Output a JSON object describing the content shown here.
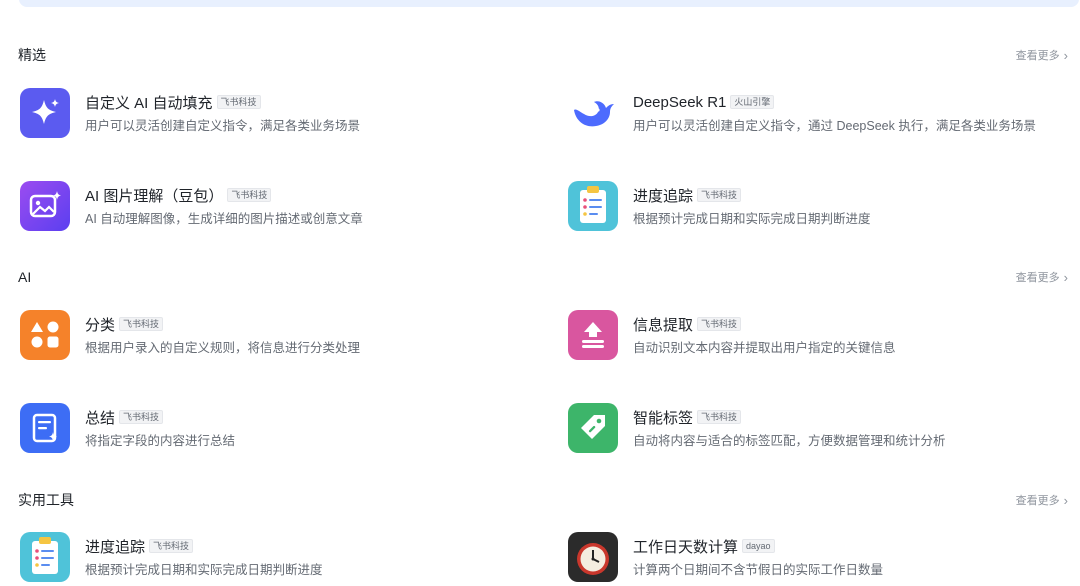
{
  "sections": [
    {
      "title": "精选",
      "see_more": "查看更多",
      "cards": [
        {
          "title": "自定义 AI 自动填充",
          "tag": "飞书科技",
          "desc": "用户可以灵活创建自定义指令，满足各类业务场景",
          "icon": "sparkle-icon",
          "color": "#5b5bf0"
        },
        {
          "title": "DeepSeek R1",
          "tag": "火山引擎",
          "desc": "用户可以灵活创建自定义指令，通过 DeepSeek 执行，满足各类业务场景",
          "icon": "deepseek-whale-icon",
          "color": "#4d6bfe"
        },
        {
          "title": "AI 图片理解（豆包）",
          "tag": "飞书科技",
          "desc": "AI 自动理解图像，生成详细的图片描述或创意文章",
          "icon": "image-sparkle-icon",
          "color": "#7a45f0"
        },
        {
          "title": "进度追踪",
          "tag": "飞书科技",
          "desc": "根据预计完成日期和实际完成日期判断进度",
          "icon": "clipboard-list-icon",
          "color": "#4fc3d9"
        }
      ]
    },
    {
      "title": "AI",
      "see_more": "查看更多",
      "cards": [
        {
          "title": "分类",
          "tag": "飞书科技",
          "desc": "根据用户录入的自定义规则，将信息进行分类处理",
          "icon": "category-shapes-icon",
          "color": "#f5822a"
        },
        {
          "title": "信息提取",
          "tag": "飞书科技",
          "desc": "自动识别文本内容并提取出用户指定的关键信息",
          "icon": "extract-upload-icon",
          "color": "#d9569f"
        },
        {
          "title": "总结",
          "tag": "飞书科技",
          "desc": "将指定字段的内容进行总结",
          "icon": "summary-doc-icon",
          "color": "#3d6df5"
        },
        {
          "title": "智能标签",
          "tag": "飞书科技",
          "desc": "自动将内容与适合的标签匹配，方便数据管理和统计分析",
          "icon": "tag-icon",
          "color": "#3db56a"
        }
      ]
    },
    {
      "title": "实用工具",
      "see_more": "查看更多",
      "cards": [
        {
          "title": "进度追踪",
          "tag": "飞书科技",
          "desc": "根据预计完成日期和实际完成日期判断进度",
          "icon": "clipboard-list-icon",
          "color": "#4fc3d9"
        },
        {
          "title": "工作日天数计算",
          "tag": "dayao",
          "desc": "计算两个日期间不含节假日的实际工作日数量",
          "icon": "alarm-clock-icon",
          "color": "#2b2b2b"
        }
      ]
    }
  ]
}
